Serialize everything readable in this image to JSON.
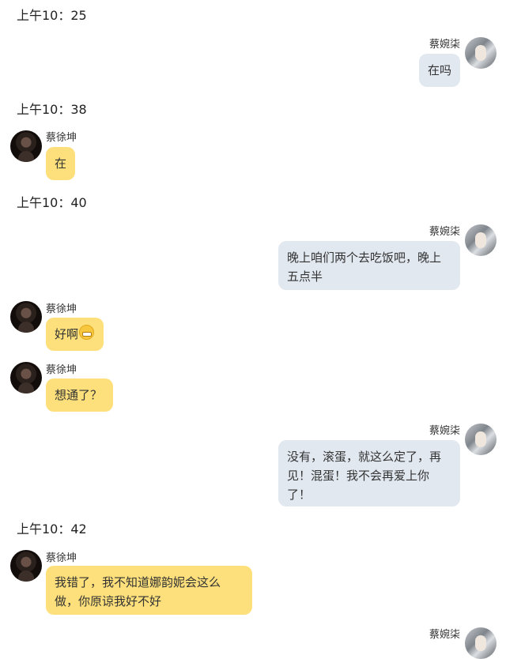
{
  "chat": {
    "participants": {
      "left_name": "蔡徐坤",
      "right_name": "蔡婉柒"
    },
    "timestamps": [
      "上午10：25",
      "上午10：38",
      "上午10：40",
      "上午10：42"
    ],
    "messages": [
      {
        "sender": "蔡婉柒",
        "text": "在吗"
      },
      {
        "sender": "蔡徐坤",
        "text": "在"
      },
      {
        "sender": "蔡婉柒",
        "text": "晚上咱们两个去吃饭吧，晚上五点半"
      },
      {
        "sender": "蔡徐坤",
        "text": "好啊",
        "emoji": "grin-emoji"
      },
      {
        "sender": "蔡徐坤",
        "text": "想通了？"
      },
      {
        "sender": "蔡婉柒",
        "text": "没有，滚蛋，就这么定了，再见！混蛋！我不会再爱上你了！"
      },
      {
        "sender": "蔡徐坤",
        "text": "我错了，我不知道娜韵妮会这么做，你原谅我好不好"
      }
    ],
    "colors": {
      "left_bubble": "#fde07b",
      "right_bubble": "#e2e8f0",
      "background": "#ffffff"
    }
  }
}
